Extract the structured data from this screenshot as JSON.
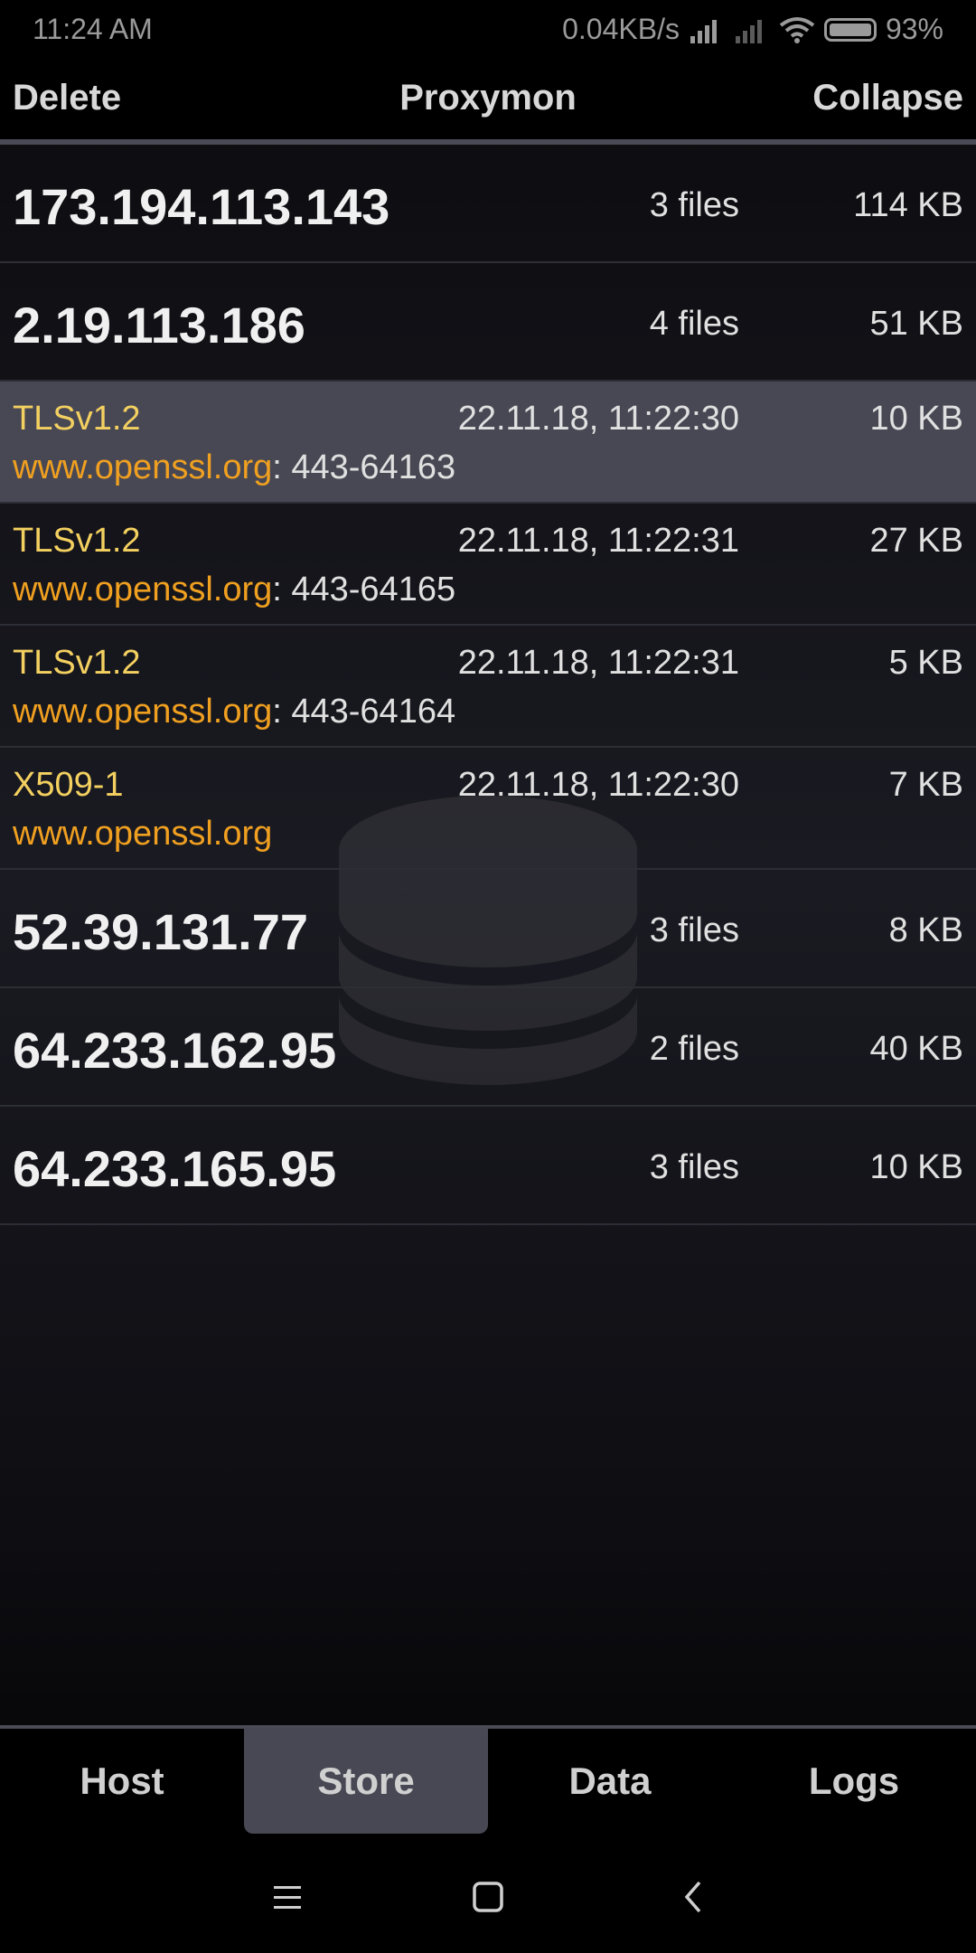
{
  "status": {
    "time": "11:24 AM",
    "speed": "0.04KB/s",
    "battery": "93%"
  },
  "topbar": {
    "delete": "Delete",
    "title": "Proxymon",
    "collapse": "Collapse"
  },
  "rows": [
    {
      "type": "host",
      "ip": "173.194.113.143",
      "files": "3 files",
      "size": "114 KB"
    },
    {
      "type": "host",
      "ip": "2.19.113.186",
      "files": "4 files",
      "size": "51 KB"
    },
    {
      "type": "file",
      "proto": "TLSv1.2",
      "time": "22.11.18, 11:22:30",
      "size": "10 KB",
      "host": "www.openssl.org",
      "port": ": 443-64163",
      "selected": true
    },
    {
      "type": "file",
      "proto": "TLSv1.2",
      "time": "22.11.18, 11:22:31",
      "size": "27 KB",
      "host": "www.openssl.org",
      "port": ": 443-64165"
    },
    {
      "type": "file",
      "proto": "TLSv1.2",
      "time": "22.11.18, 11:22:31",
      "size": "5 KB",
      "host": "www.openssl.org",
      "port": ": 443-64164"
    },
    {
      "type": "file",
      "proto": "X509-1",
      "time": "22.11.18, 11:22:30",
      "size": "7 KB",
      "host": "www.openssl.org",
      "port": ""
    },
    {
      "type": "host",
      "ip": "52.39.131.77",
      "files": "3 files",
      "size": "8 KB"
    },
    {
      "type": "host",
      "ip": "64.233.162.95",
      "files": "2 files",
      "size": "40 KB"
    },
    {
      "type": "host",
      "ip": "64.233.165.95",
      "files": "3 files",
      "size": "10 KB"
    }
  ],
  "tabs": [
    {
      "label": "Host",
      "active": false
    },
    {
      "label": "Store",
      "active": true
    },
    {
      "label": "Data",
      "active": false
    },
    {
      "label": "Logs",
      "active": false
    }
  ],
  "colors": {
    "accent_proto": "#f3d060",
    "accent_host": "#f0a020",
    "selected_bg": "#484854"
  }
}
